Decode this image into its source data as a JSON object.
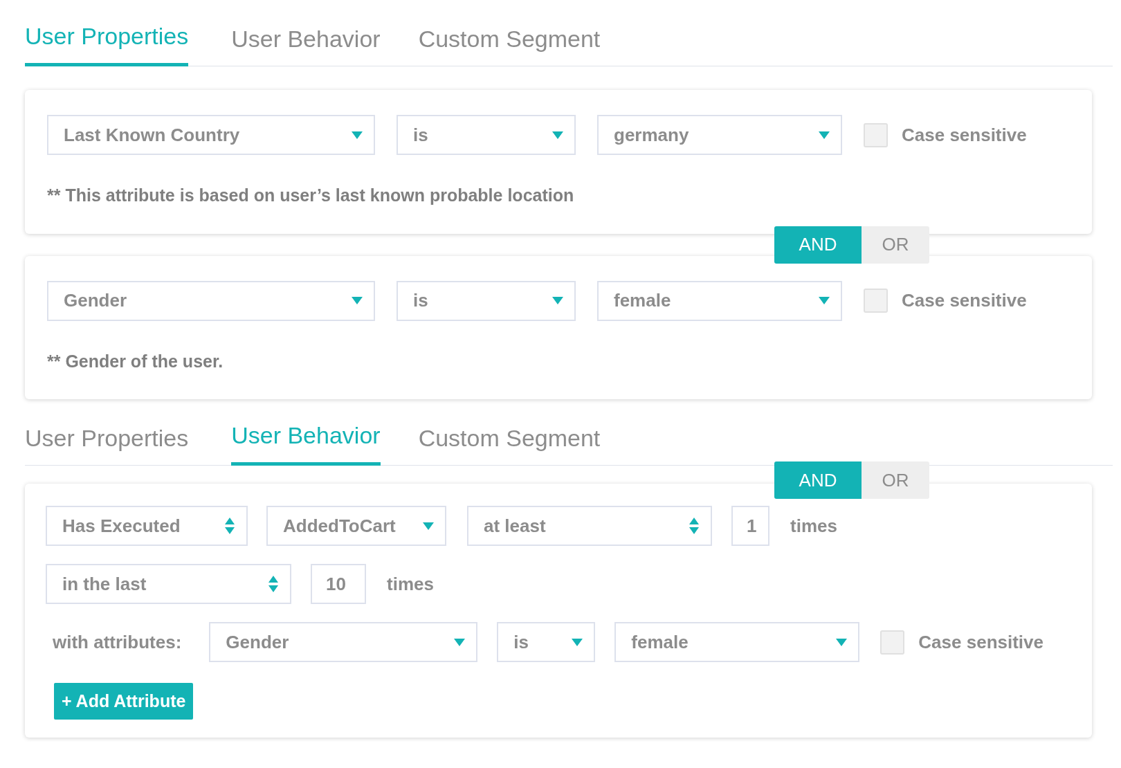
{
  "property_panel": {
    "tabs": [
      {
        "label": "User Properties",
        "selected": true
      },
      {
        "label": "User Behavior",
        "selected": false
      },
      {
        "label": "Custom Segment",
        "selected": false
      }
    ],
    "conditions": [
      {
        "fields": [
          {
            "kind": "dropdown",
            "value": "Last Known Country"
          },
          {
            "kind": "dropdown",
            "value": "is"
          },
          {
            "kind": "dropdown",
            "value": "germany"
          },
          {
            "kind": "checkbox",
            "label": "Case sensitive",
            "checked": false
          }
        ],
        "note": "** This attribute is based on user’s last known probable location"
      },
      {
        "joined_by": [
          {
            "label": "AND",
            "selected": true
          },
          {
            "label": "OR",
            "selected": false
          }
        ],
        "fields": [
          {
            "kind": "dropdown",
            "value": "Gender"
          },
          {
            "kind": "dropdown",
            "value": "is"
          },
          {
            "kind": "dropdown",
            "value": "female"
          },
          {
            "kind": "checkbox",
            "label": "Case sensitive",
            "checked": false
          }
        ],
        "note": "** Gender of the user."
      }
    ]
  },
  "behavior_panel": {
    "tabs": [
      {
        "label": "User Properties",
        "selected": false
      },
      {
        "label": "User Behavior",
        "selected": true
      },
      {
        "label": "Custom Segment",
        "selected": false
      }
    ],
    "joined_by": [
      {
        "label": "AND",
        "selected": true
      },
      {
        "label": "OR",
        "selected": false
      }
    ],
    "rows": [
      [
        {
          "kind": "spinner",
          "value": "Has Executed"
        },
        {
          "kind": "dropdown",
          "value": "AddedToCart"
        },
        {
          "kind": "spinner",
          "value": "at least"
        },
        {
          "kind": "number",
          "value": "1"
        },
        {
          "kind": "text",
          "value": "times"
        }
      ],
      [
        {
          "kind": "spinner",
          "value": "in the last"
        },
        {
          "kind": "number",
          "value": "10"
        },
        {
          "kind": "text",
          "value": "times"
        }
      ],
      [
        {
          "kind": "text",
          "value": "with attributes:"
        },
        {
          "kind": "dropdown",
          "value": "Gender"
        },
        {
          "kind": "dropdown",
          "value": "is"
        },
        {
          "kind": "dropdown",
          "value": "female"
        },
        {
          "kind": "checkbox",
          "label": "Case sensitive",
          "checked": false
        }
      ]
    ],
    "add_button": "+ Add Attribute"
  }
}
